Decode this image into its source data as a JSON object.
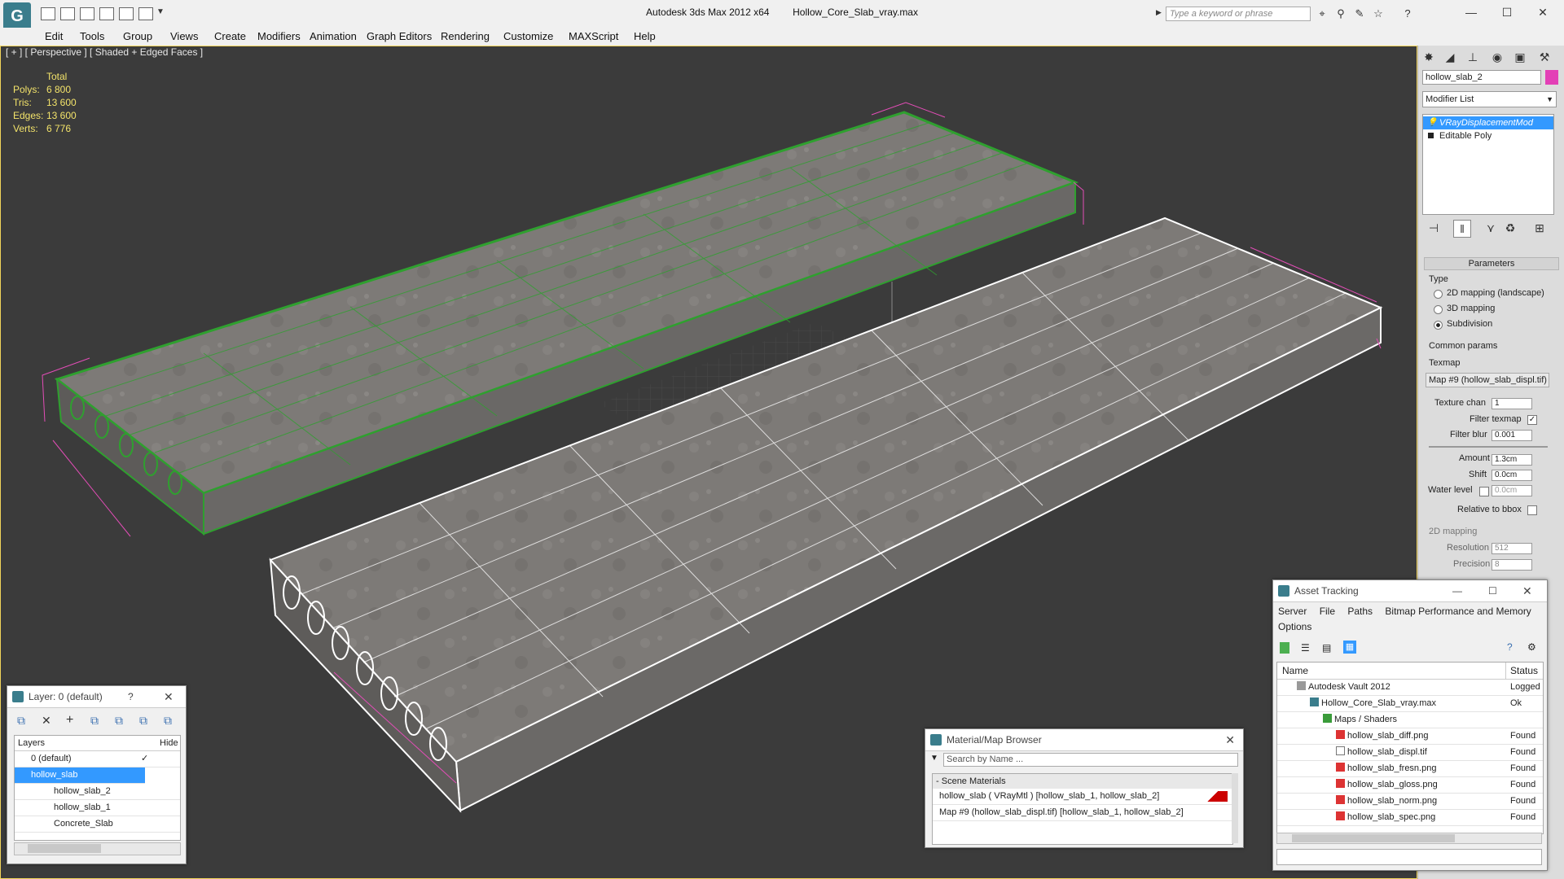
{
  "window": {
    "app_title": "Autodesk 3ds Max  2012 x64",
    "file_name": "Hollow_Core_Slab_vray.max",
    "search_placeholder": "Type a keyword or phrase"
  },
  "menu": [
    "Edit",
    "Tools",
    "Group",
    "Views",
    "Create",
    "Modifiers",
    "Animation",
    "Graph Editors",
    "Rendering",
    "Customize",
    "MAXScript",
    "Help"
  ],
  "viewport": {
    "label": "[ + ] [ Perspective ] [ Shaded + Edged Faces ]",
    "stats_header": "Total",
    "stats": [
      {
        "label": "Polys:",
        "value": "6 800"
      },
      {
        "label": "Tris:",
        "value": "13 600"
      },
      {
        "label": "Edges:",
        "value": "13 600"
      },
      {
        "label": "Verts:",
        "value": "6 776"
      }
    ]
  },
  "command_panel": {
    "object_name": "hollow_slab_2",
    "object_color": "#e33fb6",
    "modifier_list": "Modifier List",
    "stack": [
      "VRayDisplacementMod",
      "Editable Poly"
    ],
    "parameters_title": "Parameters",
    "type_label": "Type",
    "type_options": [
      "2D mapping (landscape)",
      "3D mapping",
      "Subdivision"
    ],
    "type_selected": 2,
    "common_params": "Common params",
    "texmap_label": "Texmap",
    "texmap_value": "Map #9 (hollow_slab_displ.tif)",
    "texture_chan_label": "Texture chan",
    "texture_chan_value": "1",
    "filter_texmap_label": "Filter texmap",
    "filter_blur_label": "Filter blur",
    "filter_blur_value": "0.001",
    "amount_label": "Amount",
    "amount_value": "1.3cm",
    "shift_label": "Shift",
    "shift_value": "0.0cm",
    "water_level_label": "Water level",
    "water_level_value": "0.0cm",
    "relative_bbox_label": "Relative to bbox",
    "mapping2d_title": "2D mapping",
    "resolution_label": "Resolution",
    "resolution_value": "512",
    "precision_label": "Precision",
    "precision_value": "8"
  },
  "layer_dialog": {
    "title": "Layer: 0 (default)",
    "help": "?",
    "col_layers": "Layers",
    "col_hide": "Hide",
    "rows": [
      {
        "name": "0 (default)",
        "indent": 0,
        "selected": false
      },
      {
        "name": "hollow_slab",
        "indent": 0,
        "selected": true
      },
      {
        "name": "hollow_slab_2",
        "indent": 1,
        "selected": false
      },
      {
        "name": "hollow_slab_1",
        "indent": 1,
        "selected": false
      },
      {
        "name": "Concrete_Slab",
        "indent": 1,
        "selected": false
      }
    ]
  },
  "material_browser": {
    "title": "Material/Map Browser",
    "search_placeholder": "Search by Name ...",
    "section": "Scene Materials",
    "items": [
      "hollow_slab  ( VRayMtl ) [hollow_slab_1, hollow_slab_2]",
      "Map #9 (hollow_slab_displ.tif) [hollow_slab_1, hollow_slab_2]"
    ]
  },
  "asset_tracking": {
    "title": "Asset Tracking",
    "menu": [
      "Server",
      "File",
      "Paths",
      "Bitmap Performance and Memory",
      "Options"
    ],
    "col_name": "Name",
    "col_status": "Status",
    "rows": [
      {
        "name": "Autodesk Vault 2012",
        "status": "Logged O",
        "indent": 1,
        "icon": "vault"
      },
      {
        "name": "Hollow_Core_Slab_vray.max",
        "status": "Ok",
        "indent": 2,
        "icon": "max"
      },
      {
        "name": "Maps / Shaders",
        "status": "",
        "indent": 3,
        "icon": "maps"
      },
      {
        "name": "hollow_slab_diff.png",
        "status": "Found",
        "indent": 4,
        "icon": "png"
      },
      {
        "name": "hollow_slab_displ.tif",
        "status": "Found",
        "indent": 4,
        "icon": "tif"
      },
      {
        "name": "hollow_slab_fresn.png",
        "status": "Found",
        "indent": 4,
        "icon": "png"
      },
      {
        "name": "hollow_slab_gloss.png",
        "status": "Found",
        "indent": 4,
        "icon": "png"
      },
      {
        "name": "hollow_slab_norm.png",
        "status": "Found",
        "indent": 4,
        "icon": "png"
      },
      {
        "name": "hollow_slab_spec.png",
        "status": "Found",
        "indent": 4,
        "icon": "png"
      }
    ]
  },
  "colors": {
    "selection_wire": "#2fa02f",
    "wireframe": "#ffffff",
    "bbox": "#e34db7",
    "stats_text": "#f3e36a",
    "highlight": "#3399ff"
  }
}
